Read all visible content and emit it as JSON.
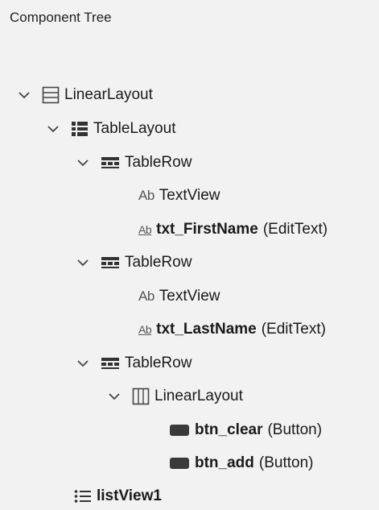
{
  "panel": {
    "title": "Component Tree"
  },
  "tree": [
    {
      "label": "LinearLayout",
      "type": "",
      "bold": false,
      "icon": "linear-layout-vertical-icon",
      "expanded": true
    },
    {
      "label": "TableLayout",
      "type": "",
      "bold": false,
      "icon": "table-layout-icon",
      "expanded": true
    },
    {
      "label": "TableRow",
      "type": "",
      "bold": false,
      "icon": "table-row-icon",
      "expanded": true
    },
    {
      "label": "TextView",
      "type": "",
      "bold": false,
      "icon": "textview-icon",
      "icon_text": "Ab"
    },
    {
      "label": "txt_FirstName",
      "type": "(EditText)",
      "bold": true,
      "icon": "edittext-icon",
      "icon_text": "Ab"
    },
    {
      "label": "TableRow",
      "type": "",
      "bold": false,
      "icon": "table-row-icon",
      "expanded": true
    },
    {
      "label": "TextView",
      "type": "",
      "bold": false,
      "icon": "textview-icon",
      "icon_text": "Ab"
    },
    {
      "label": "txt_LastName",
      "type": "(EditText)",
      "bold": true,
      "icon": "edittext-icon",
      "icon_text": "Ab"
    },
    {
      "label": "TableRow",
      "type": "",
      "bold": false,
      "icon": "table-row-icon",
      "expanded": true
    },
    {
      "label": "LinearLayout",
      "type": "",
      "bold": false,
      "icon": "linear-layout-horizontal-icon",
      "expanded": true
    },
    {
      "label": "btn_clear",
      "type": "(Button)",
      "bold": true,
      "icon": "button-icon"
    },
    {
      "label": "btn_add",
      "type": "(Button)",
      "bold": true,
      "icon": "button-icon"
    },
    {
      "label": "listView1",
      "type": "",
      "bold": true,
      "icon": "listview-icon"
    }
  ]
}
